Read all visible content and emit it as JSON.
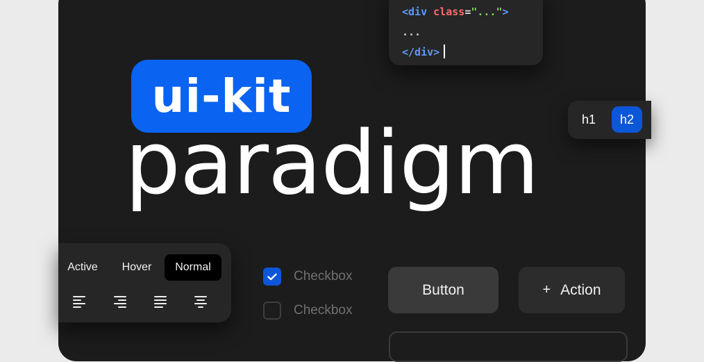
{
  "code": {
    "line1_open": "<div",
    "line1_attr": " class",
    "line1_eq": "=",
    "line1_str": "\"...\"",
    "line1_close": ">",
    "line2": "...",
    "line3": "</div>"
  },
  "heading_toggle": {
    "h1_label": "h1",
    "h2_label": "h2",
    "selected": "h2"
  },
  "brand": {
    "badge": "ui-kit",
    "title": "paradigm"
  },
  "states": {
    "active_label": "Active",
    "hover_label": "Hover",
    "normal_label": "Normal",
    "selected": "Normal"
  },
  "alignment_icons": [
    "align-left-icon",
    "align-right-icon",
    "align-justify-icon",
    "align-center-icon"
  ],
  "checkboxes": [
    {
      "label": "Checkbox",
      "checked": true
    },
    {
      "label": "Checkbox",
      "checked": false
    }
  ],
  "buttons": {
    "primary_label": "Button",
    "action_label": "Action",
    "action_icon": "plus-icon"
  },
  "colors": {
    "accent": "#0a63f1",
    "card": "#1c1c1c",
    "panel": "#262626"
  }
}
